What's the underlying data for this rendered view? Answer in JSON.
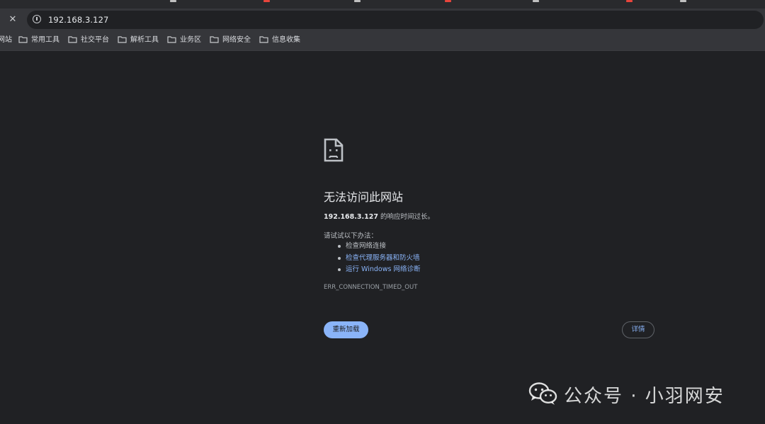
{
  "tabstrip": {
    "mark_colors": [
      "#c0c0c0",
      "#e8453c",
      "#c0c0c0",
      "#e8453c",
      "#c0c0c0",
      "#e8453c",
      "#c0c0c0"
    ]
  },
  "toolbar": {
    "close_icon": "close-icon",
    "info_icon": "info-icon",
    "url": "192.168.3.127"
  },
  "bookmarks": {
    "items": [
      {
        "label": "网站",
        "icon": "none"
      },
      {
        "label": "常用工具",
        "icon": "folder-icon"
      },
      {
        "label": "社交平台",
        "icon": "folder-icon"
      },
      {
        "label": "解析工具",
        "icon": "folder-icon"
      },
      {
        "label": "业务区",
        "icon": "folder-icon"
      },
      {
        "label": "网络安全",
        "icon": "folder-icon"
      },
      {
        "label": "信息收集",
        "icon": "folder-icon"
      }
    ]
  },
  "error_page": {
    "icon": "sad-page-icon",
    "title": "无法访问此网站",
    "host": "192.168.3.127",
    "message_suffix": " 的响应时间过长。",
    "try_label": "请试试以下办法：",
    "suggestions": [
      {
        "label": "检查网络连接",
        "is_link": false
      },
      {
        "label": "检查代理服务器和防火墙",
        "is_link": true
      },
      {
        "label": "运行 Windows 网络诊断",
        "is_link": true
      }
    ],
    "error_code": "ERR_CONNECTION_TIMED_OUT",
    "reload_label": "重新加载",
    "details_label": "详情"
  },
  "watermark": {
    "icon": "wechat-icon",
    "text": "公众号 · 小羽网安"
  },
  "colors": {
    "background": "#202124",
    "chrome": "#35363a",
    "link": "#8ab4f8",
    "text": "#e8eaed"
  }
}
